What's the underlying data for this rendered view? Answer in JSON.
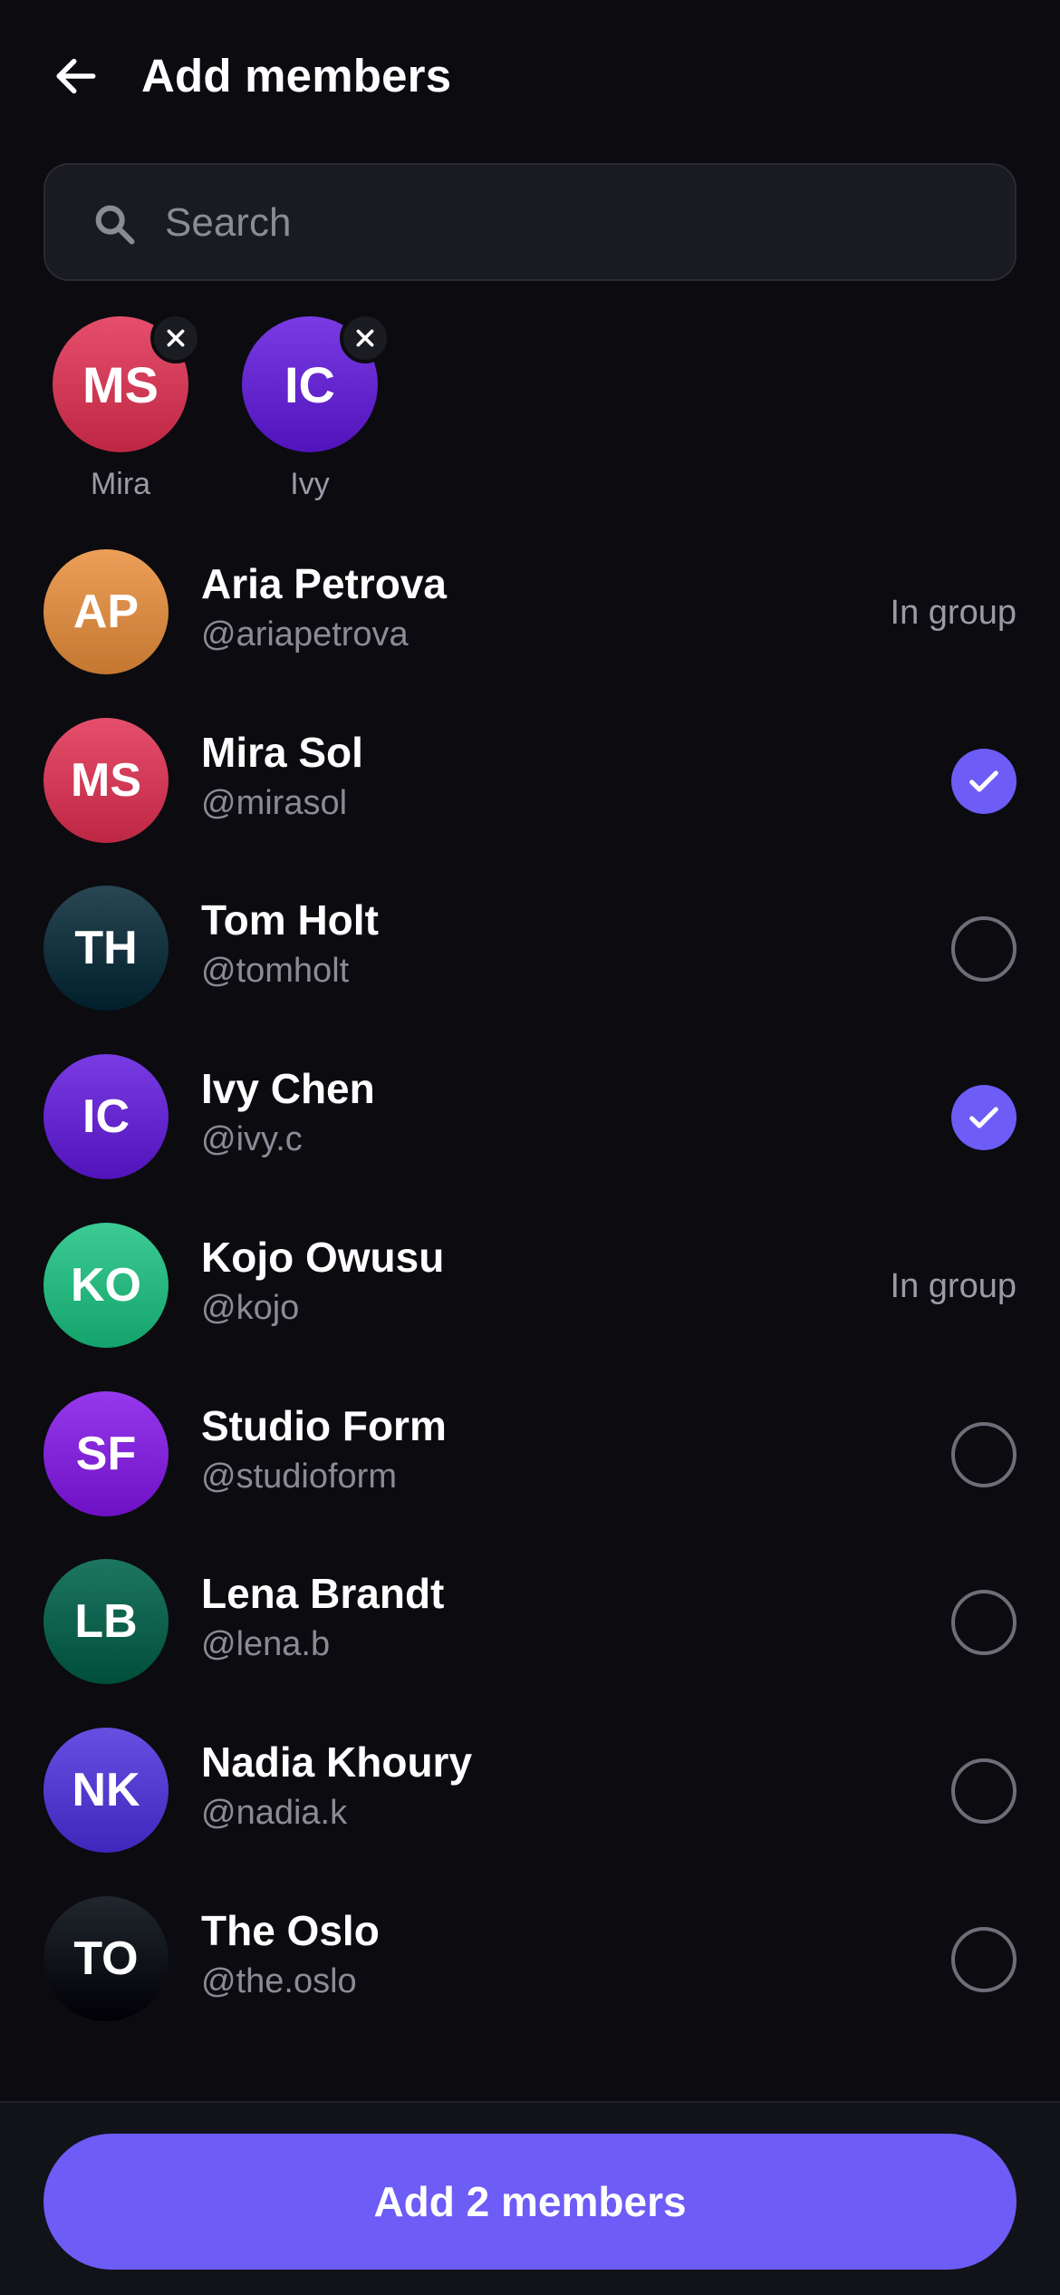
{
  "header": {
    "title": "Add members",
    "back_icon": "arrow-left-icon"
  },
  "search": {
    "placeholder": "Search",
    "value": "",
    "icon": "search-icon"
  },
  "selected_chips": [
    {
      "initials": "MS",
      "name": "Mira",
      "color": "#d9435f"
    },
    {
      "initials": "IC",
      "name": "Ivy",
      "color": "#6d2fd6"
    }
  ],
  "members": [
    {
      "initials": "AP",
      "name": "Aria Petrova",
      "handle": "@ariapetrova",
      "status": "In group",
      "state": "in_group",
      "color": "#e0934c"
    },
    {
      "initials": "MS",
      "name": "Mira Sol",
      "handle": "@mirasol",
      "status": "",
      "state": "selected",
      "color": "#d9435f"
    },
    {
      "initials": "TH",
      "name": "Tom Holt",
      "handle": "@tomholt",
      "status": "",
      "state": "unselected",
      "color": "#1d3b47"
    },
    {
      "initials": "IC",
      "name": "Ivy Chen",
      "handle": "@ivy.c",
      "status": "",
      "state": "selected",
      "color": "#6d2fd6"
    },
    {
      "initials": "KO",
      "name": "Kojo Owusu",
      "handle": "@kojo",
      "status": "In group",
      "state": "in_group",
      "color": "#2fbf87"
    },
    {
      "initials": "SF",
      "name": "Studio Form",
      "handle": "@studioform",
      "status": "",
      "state": "unselected",
      "color": "#8a2ce0"
    },
    {
      "initials": "LB",
      "name": "Lena Brandt",
      "handle": "@lena.b",
      "status": "",
      "state": "unselected",
      "color": "#116a55"
    },
    {
      "initials": "NK",
      "name": "Nadia Khoury",
      "handle": "@nadia.k",
      "status": "",
      "state": "unselected",
      "color": "#5a43d6"
    },
    {
      "initials": "TO",
      "name": "The Oslo",
      "handle": "@the.oslo",
      "status": "",
      "state": "unselected",
      "color": "#151b22"
    }
  ],
  "footer": {
    "button_label": "Add 2 members"
  },
  "colors": {
    "accent": "#6d5cf5",
    "background": "#0b0b10"
  }
}
